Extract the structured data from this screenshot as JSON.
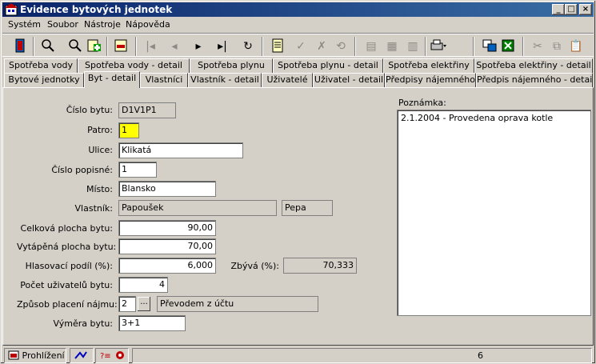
{
  "window": {
    "title": "Evidence bytových jednotek",
    "min_label": "_",
    "max_label": "□",
    "close_label": "×"
  },
  "menu": [
    "Systém",
    "Soubor",
    "Nástroje",
    "Nápověda"
  ],
  "tabs_row1": [
    "Spotřeba vody",
    "Spotřeba vody - detail",
    "Spotřeba plynu",
    "Spotřeba plynu - detail",
    "Spotřeba elektřiny",
    "Spotřeba elektřiny - detail"
  ],
  "tabs_row2": [
    "Bytové jednotky",
    "Byt - detail",
    "Vlastníci",
    "Vlastník - detail",
    "Uživatelé",
    "Uživatel - detail",
    "Předpisy nájemného",
    "Předpis nájemného - detail"
  ],
  "active_tab": "Byt - detail",
  "form": {
    "cislo_bytu_label": "Číslo bytu:",
    "cislo_bytu": "D1V1P1",
    "patro_label": "Patro:",
    "patro": "1",
    "ulice_label": "Ulice:",
    "ulice": "Klikatá",
    "cislo_popisne_label": "Číslo popisné:",
    "cislo_popisne": "1",
    "misto_label": "Místo:",
    "misto": "Blansko",
    "vlastnik_label": "Vlastník:",
    "vlastnik_prijmeni": "Papoušek",
    "vlastnik_jmeno": "Pepa",
    "celkova_plocha_label": "Celková plocha bytu:",
    "celkova_plocha": "90,00",
    "vytapena_plocha_label": "Vytápěná plocha bytu:",
    "vytapena_plocha": "70,00",
    "hlasovaci_podil_label": "Hlasovací podíl (%):",
    "hlasovaci_podil": "6,000",
    "zbyva_label": "Zbývá (%):",
    "zbyva": "70,333",
    "pocet_uzivatelu_label": "Počet uživatelů bytu:",
    "pocet_uzivatelu": "4",
    "zpusob_placeni_label": "Způsob placení nájmu:",
    "zpusob_placeni_kod": "2",
    "zpusob_placeni_text": "Převodem z účtu",
    "ellipsis": "...",
    "vymera_label": "Výměra bytu:",
    "vymera": "3+1"
  },
  "note": {
    "label": "Poznámka:",
    "text": "2.1.2004 - Provedena oprava kotle"
  },
  "status": {
    "mode": "Prohlížení",
    "record": "6"
  },
  "toolbar": {
    "icons": [
      "exit-icon",
      "search-icon",
      "find-next-icon",
      "add-record-icon",
      "delete-record-icon",
      "first-icon",
      "prev-icon",
      "next-icon",
      "last-icon",
      "refresh-icon",
      "edit-icon",
      "confirm-icon",
      "cancel-icon",
      "undo-icon",
      "form-view-icon",
      "grid-view-icon",
      "table-view-icon",
      "print-icon",
      "copy-data-icon",
      "export-icon",
      "cut-icon",
      "copy-icon",
      "paste-icon"
    ]
  },
  "colors": {
    "title_start": "#0a246a",
    "title_end": "#3a6ea5",
    "face": "#d4d0c8",
    "highlight": "#ffff00"
  }
}
